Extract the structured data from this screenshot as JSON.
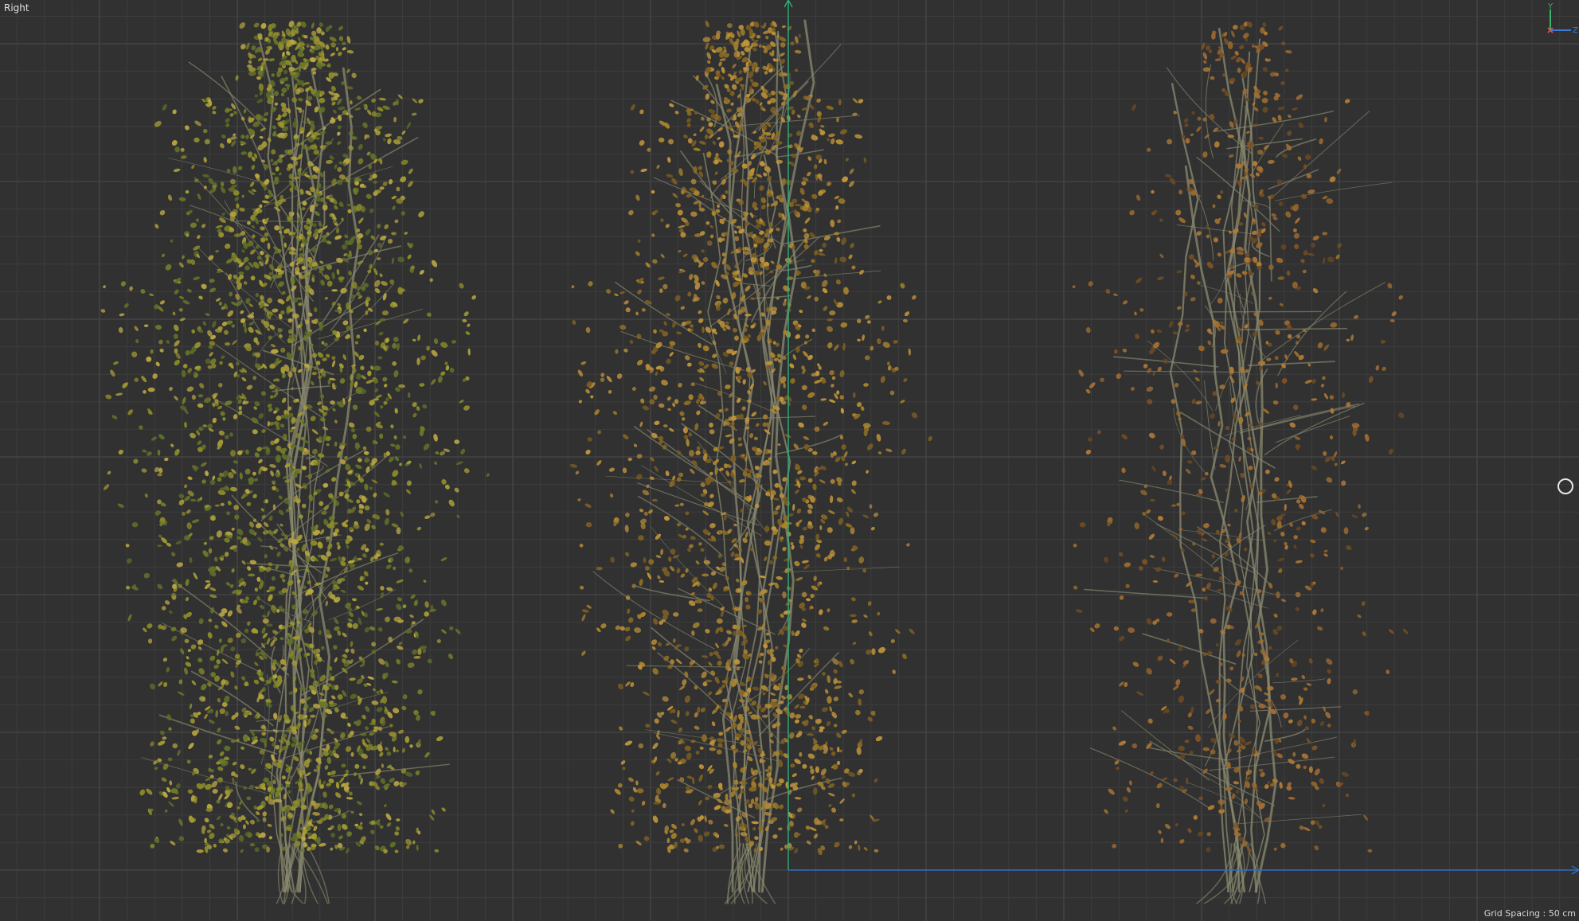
{
  "viewport": {
    "view_name": "Right",
    "grid_spacing_label": "Grid Spacing : 50 cm",
    "background_color": "#313131",
    "grid_color": "#3d3d3d",
    "grid_major_color": "#474747"
  },
  "axis_gizmo": {
    "y_label": "Y",
    "z_label": "Z",
    "y_color": "#3fb36b",
    "z_color": "#3b7dd8",
    "x_color": "#d9534f"
  },
  "world_axes": {
    "y_axis_color": "#2fae77",
    "z_axis_color": "#2f6fc4"
  },
  "trees": [
    {
      "variant": "summer-yellow-green",
      "leaf_density": 1.0,
      "leaf_colors": [
        "#8a8a2a",
        "#a39a34",
        "#6e7a2a",
        "#b8a543",
        "#5f6e29"
      ]
    },
    {
      "variant": "early-autumn",
      "leaf_density": 0.7,
      "leaf_colors": [
        "#a9842e",
        "#c0953a",
        "#8a6a25",
        "#b48a3b",
        "#7d5e22"
      ]
    },
    {
      "variant": "late-autumn-sparse",
      "leaf_density": 0.3,
      "leaf_colors": [
        "#9a6a2c",
        "#b07a35",
        "#7d5226",
        "#a36d33",
        "#6b4a22"
      ]
    }
  ],
  "cursor": {
    "icon": "orbit-circle-icon"
  }
}
